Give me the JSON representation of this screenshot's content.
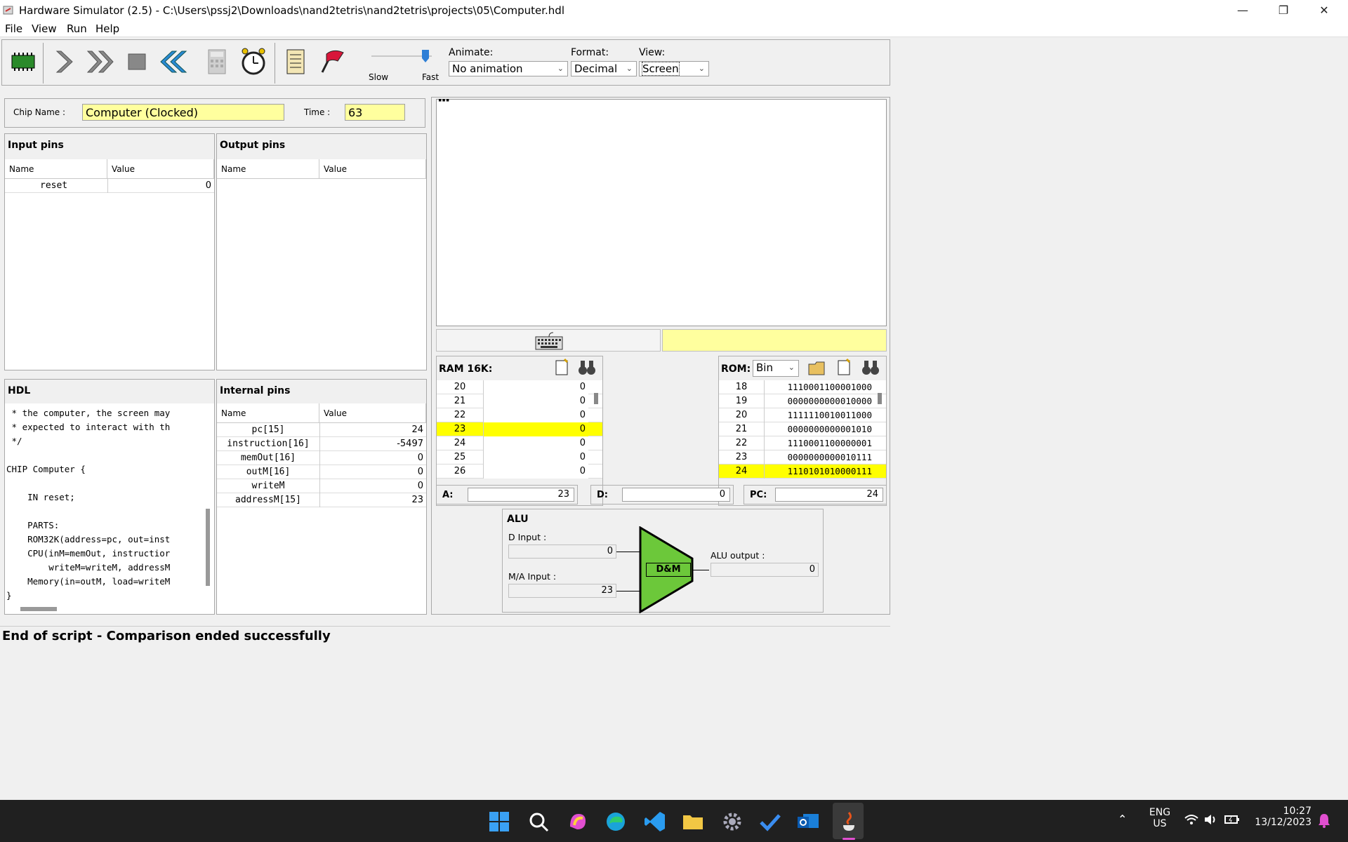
{
  "window": {
    "title": "Hardware Simulator (2.5) - C:\\Users\\pssj2\\Downloads\\nand2tetris\\nand2tetris\\projects\\05\\Computer.hdl"
  },
  "menu": [
    "File",
    "View",
    "Run",
    "Help"
  ],
  "toolbar": {
    "slow_label": "Slow",
    "fast_label": "Fast",
    "speed_level": 0.95,
    "animate_label": "Animate:",
    "animate_value": "No animation",
    "format_label": "Format:",
    "format_value": "Decimal",
    "view_label": "View:",
    "view_value": "Screen"
  },
  "chip": {
    "name_label": "Chip Name :",
    "name_value": "Computer (Clocked)",
    "time_label": "Time :",
    "time_value": "63"
  },
  "input_pins": {
    "title": "Input pins",
    "col_name": "Name",
    "col_value": "Value",
    "rows": [
      {
        "name": "reset",
        "value": "0"
      }
    ]
  },
  "output_pins": {
    "title": "Output pins",
    "col_name": "Name",
    "col_value": "Value"
  },
  "hdl": {
    "title": "HDL",
    "lines": [
      " * the computer, the screen may",
      " * expected to interact with th",
      " */",
      "",
      "CHIP Computer {",
      "",
      "    IN reset;",
      "",
      "    PARTS:",
      "    ROM32K(address=pc, out=inst",
      "    CPU(inM=memOut, instructior",
      "        writeM=writeM, addressM",
      "    Memory(in=outM, load=writeM",
      "}"
    ]
  },
  "internal_pins": {
    "title": "Internal pins",
    "col_name": "Name",
    "col_value": "Value",
    "rows": [
      {
        "name": "pc[15]",
        "value": "24"
      },
      {
        "name": "instruction[16]",
        "value": "-5497"
      },
      {
        "name": "memOut[16]",
        "value": "0"
      },
      {
        "name": "outM[16]",
        "value": "0"
      },
      {
        "name": "writeM",
        "value": "0"
      },
      {
        "name": "addressM[15]",
        "value": "23"
      }
    ]
  },
  "screen": {
    "marker": "▪▪▪"
  },
  "ram": {
    "title": "RAM 16K:",
    "rows": [
      {
        "addr": "20",
        "value": "0",
        "hl": false
      },
      {
        "addr": "21",
        "value": "0",
        "hl": false
      },
      {
        "addr": "22",
        "value": "0",
        "hl": false
      },
      {
        "addr": "23",
        "value": "0",
        "hl": true
      },
      {
        "addr": "24",
        "value": "0",
        "hl": false
      },
      {
        "addr": "25",
        "value": "0",
        "hl": false
      },
      {
        "addr": "26",
        "value": "0",
        "hl": false
      }
    ]
  },
  "rom": {
    "title": "ROM:",
    "format": "Bin",
    "rows": [
      {
        "addr": "18",
        "value": "1110001100001000",
        "hl": false
      },
      {
        "addr": "19",
        "value": "0000000000010000",
        "hl": false
      },
      {
        "addr": "20",
        "value": "1111110010011000",
        "hl": false
      },
      {
        "addr": "21",
        "value": "0000000000001010",
        "hl": false
      },
      {
        "addr": "22",
        "value": "1110001100000001",
        "hl": false
      },
      {
        "addr": "23",
        "value": "0000000000010111",
        "hl": false
      },
      {
        "addr": "24",
        "value": "1110101010000111",
        "hl": true
      }
    ]
  },
  "registers": {
    "a_label": "A:",
    "a_value": "23",
    "d_label": "D:",
    "d_value": "0",
    "pc_label": "PC:",
    "pc_value": "24"
  },
  "alu": {
    "title": "ALU",
    "d_input_label": "D Input :",
    "d_input_value": "0",
    "ma_input_label": "M/A Input :",
    "ma_input_value": "23",
    "output_label": "ALU output :",
    "output_value": "0",
    "function": "D&M"
  },
  "status": {
    "message": "End of script - Comparison ended successfully"
  },
  "taskbar": {
    "lang1": "ENG",
    "lang2": "US",
    "time": "10:27",
    "date": "13/12/2023"
  },
  "colors": {
    "highlight": "#ffff00",
    "alu_green": "#6cc83a",
    "field_yellow": "#ffff9e"
  }
}
